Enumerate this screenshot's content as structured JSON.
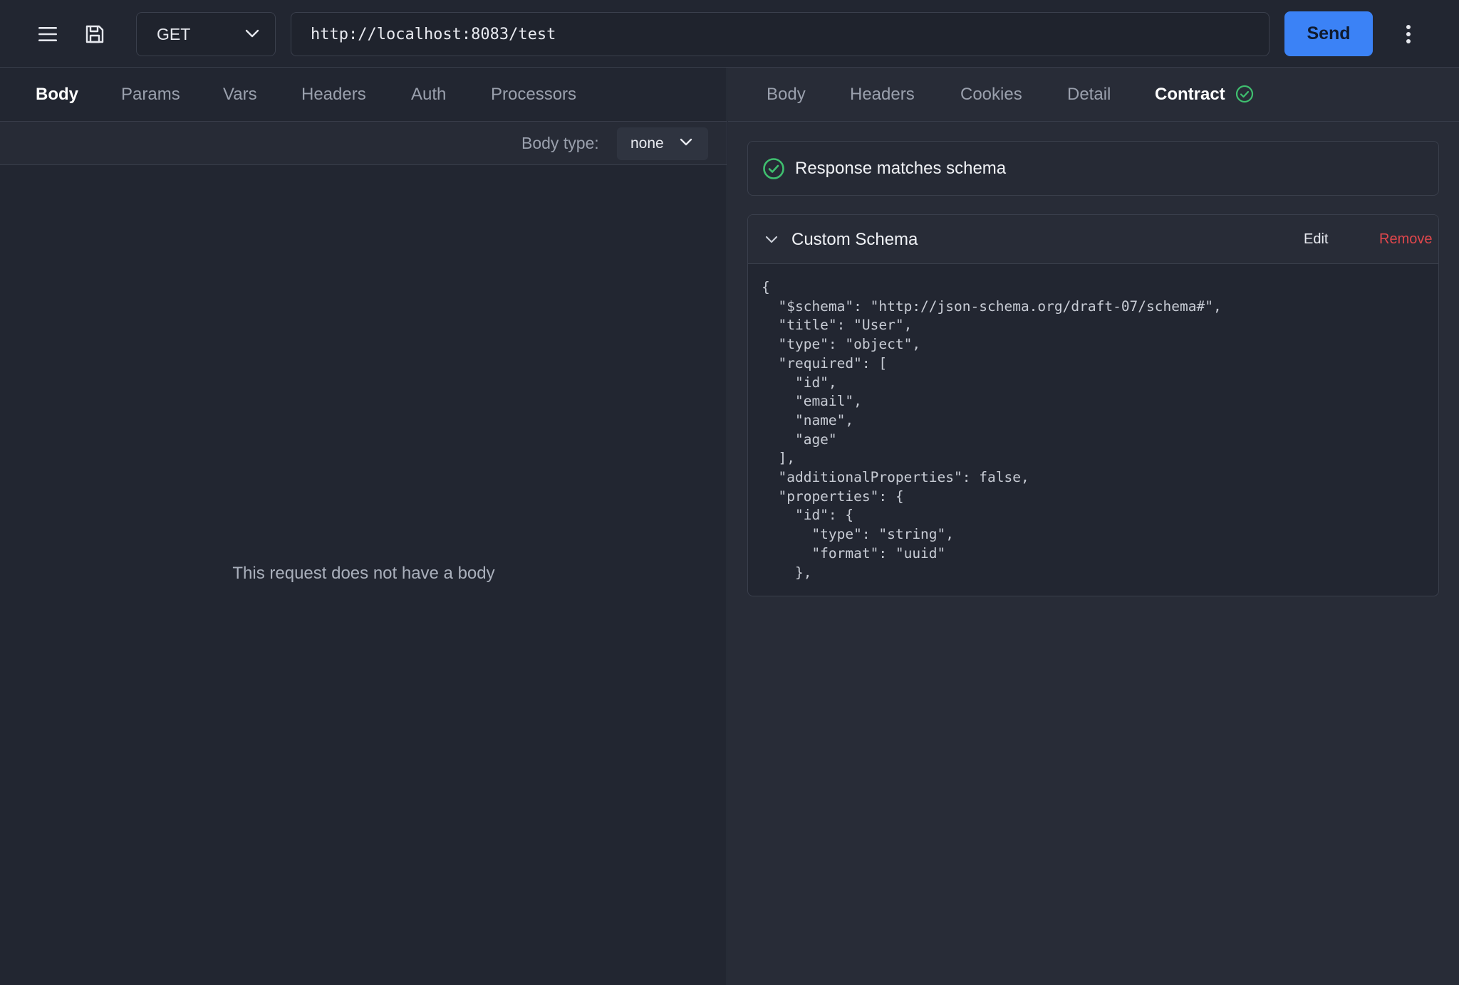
{
  "toolbar": {
    "menu_icon": "hamburger-menu-icon",
    "save_icon": "floppy-disk-icon",
    "method": "GET",
    "url": "http://localhost:8083/test",
    "send_label": "Send",
    "more_icon": "kebab-menu-icon"
  },
  "request": {
    "tabs": [
      "Body",
      "Params",
      "Vars",
      "Headers",
      "Auth",
      "Processors"
    ],
    "active_tab": "Body",
    "body_type_label": "Body type:",
    "body_type_value": "none",
    "empty_message": "This request does not have a body"
  },
  "response": {
    "tabs": [
      "Body",
      "Headers",
      "Cookies",
      "Detail",
      "Contract"
    ],
    "active_tab": "Contract",
    "match_message": "Response matches schema",
    "schema": {
      "title": "Custom Schema",
      "edit_label": "Edit",
      "remove_label": "Remove",
      "code": "{\n  \"$schema\": \"http://json-schema.org/draft-07/schema#\",\n  \"title\": \"User\",\n  \"type\": \"object\",\n  \"required\": [\n    \"id\",\n    \"email\",\n    \"name\",\n    \"age\"\n  ],\n  \"additionalProperties\": false,\n  \"properties\": {\n    \"id\": {\n      \"type\": \"string\",\n      \"format\": \"uuid\"\n    },"
    }
  },
  "colors": {
    "accent": "#3b82f6",
    "success": "#3fbf6f",
    "danger": "#e0474c"
  }
}
